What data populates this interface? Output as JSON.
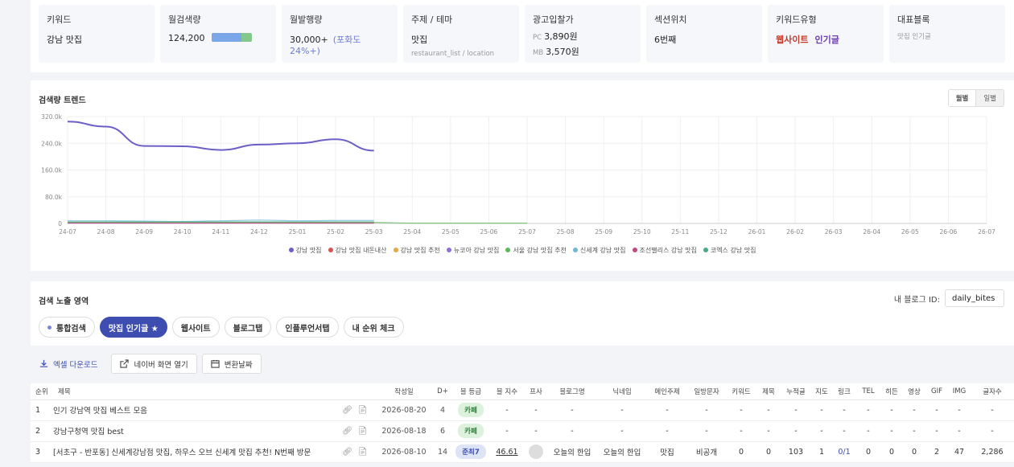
{
  "stats": [
    {
      "label": "키워드",
      "value": "강남 맛집"
    },
    {
      "label": "월검색량",
      "value": "124,200",
      "bar_fraction": 0.74
    },
    {
      "label": "월발행량",
      "value": "30,000+",
      "extra": "(포화도 24%+)"
    },
    {
      "label": "주제 / 테마",
      "value": "맛집",
      "sub": "restaurant_list / location"
    },
    {
      "label": "광고입찰가",
      "pc_label": "PC",
      "pc_value": "3,890원",
      "mb_label": "MB",
      "mb_value": "3,570원"
    },
    {
      "label": "섹션위치",
      "value": "6번째"
    },
    {
      "label": "키워드유형",
      "type1": "웹사이트",
      "type2": "인기글"
    },
    {
      "label": "대표블록",
      "sub": "맛집 인기글"
    }
  ],
  "trend": {
    "title": "검색량 트렌드",
    "toggle_on": "월별",
    "toggle_off": "일별"
  },
  "chart_data": {
    "type": "line",
    "x": [
      "24-07",
      "24-08",
      "24-09",
      "24-10",
      "24-11",
      "24-12",
      "25-01",
      "25-02",
      "25-03",
      "25-04",
      "25-05",
      "25-06",
      "25-07",
      "25-08",
      "25-09",
      "25-10",
      "25-11",
      "25-12",
      "26-01",
      "26-02",
      "26-03",
      "26-04",
      "26-05",
      "26-06",
      "26-07"
    ],
    "y_ticks": [
      "0",
      "80.0k",
      "160.0k",
      "240.0k",
      "320.0k"
    ],
    "ylim": [
      0,
      320000
    ],
    "series": [
      {
        "name": "강남 맛집",
        "color": "#6c5fc7",
        "values": [
          305000,
          290000,
          232000,
          231000,
          220000,
          236000,
          240000,
          252000,
          218000
        ]
      },
      {
        "name": "강남 맛집 내돈내산",
        "color": "#d9534f",
        "values": [
          2000,
          2000,
          1500,
          1500,
          1500,
          1500,
          1500,
          1500,
          1500
        ]
      },
      {
        "name": "강남 맛집 추천",
        "color": "#e0a84a",
        "values": [
          3000,
          3000,
          2500,
          2500,
          2500,
          2500,
          2500,
          2500,
          2500
        ]
      },
      {
        "name": "뉴코아 강남 맛집",
        "color": "#8e6fd8",
        "values": [
          1000,
          1000,
          1000,
          1000,
          1000,
          1000,
          1000,
          1000,
          1000
        ]
      },
      {
        "name": "서울 강남 맛집 추천",
        "color": "#5cb85c",
        "values": [
          3500,
          3500,
          3000,
          3000,
          3500,
          3500,
          3000,
          3000,
          3000,
          1000,
          1000,
          1000,
          1000
        ]
      },
      {
        "name": "신세계 강남 맛집",
        "color": "#6fb6d8",
        "values": [
          8000,
          8000,
          7000,
          6000,
          8000,
          10000,
          8000,
          9000,
          9000
        ]
      },
      {
        "name": "조선팰리스 강남 맛집",
        "color": "#c2477e",
        "values": [
          1000,
          1000,
          1000,
          1000,
          1000,
          1000,
          1000,
          1000,
          1000
        ]
      },
      {
        "name": "코엑스 강남 맛집",
        "color": "#4aa88a",
        "values": [
          5000,
          5000,
          5000,
          5000,
          5000,
          5000,
          5000,
          5000,
          5000
        ]
      }
    ]
  },
  "search": {
    "title": "검색 노출 영역",
    "blog_id_label": "내 블로그 ID:",
    "blog_id_value": "daily_bites",
    "tabs": [
      "통합검색",
      "맛집 인기글 ★",
      "웹사이트",
      "블로그탭",
      "인플루언서탭",
      "내 순위 체크"
    ]
  },
  "actions": {
    "excel": "엑셀 다운로드",
    "naver": "네이버 화면 열기",
    "date": "변환날짜"
  },
  "table": {
    "headers": [
      "순위",
      "제목",
      "",
      "작성일",
      "D+",
      "블 등급",
      "블 지수",
      "프사",
      "블로그명",
      "닉네임",
      "메인주제",
      "일방문자",
      "키워드",
      "제목",
      "누적글",
      "지도",
      "링크",
      "TEL",
      "히든",
      "영상",
      "GIF",
      "IMG",
      "글자수"
    ],
    "rows": [
      {
        "rank": "1",
        "title": "인기 강남역 맛집 베스트 모음",
        "date": "2026-08-20",
        "d": "4",
        "grade": "카페",
        "grade_type": "cafe",
        "index": "-",
        "photo": "-",
        "blog": "-",
        "nick": "-",
        "topic": "-",
        "visitors": "-",
        "kw": "-",
        "tt": "-",
        "posts": "-",
        "map": "-",
        "link": "-",
        "tel": "-",
        "hidden": "-",
        "video": "-",
        "gif": "-",
        "img": "-",
        "chars": "-"
      },
      {
        "rank": "2",
        "title": "강남구청역 맛집 best",
        "date": "2026-08-18",
        "d": "6",
        "grade": "카페",
        "grade_type": "cafe",
        "index": "-",
        "photo": "-",
        "blog": "-",
        "nick": "-",
        "topic": "-",
        "visitors": "-",
        "kw": "-",
        "tt": "-",
        "posts": "-",
        "map": "-",
        "link": "-",
        "tel": "-",
        "hidden": "-",
        "video": "-",
        "gif": "-",
        "img": "-",
        "chars": "-"
      },
      {
        "rank": "3",
        "title": "[서초구 - 반포동] 신세계강남점 맛집, 하우스 오브 신세계 맛집 추천! N번째 방문",
        "date": "2026-08-10",
        "d": "14",
        "grade": "준최7",
        "grade_type": "jun",
        "index": "46.61",
        "photo": "",
        "blog": "오늘의 한입",
        "nick": "오늘의 한입",
        "topic": "맛집",
        "visitors": "비공개",
        "kw": "0",
        "tt": "0",
        "posts": "103",
        "map": "1",
        "link": "0/1",
        "tel": "0",
        "hidden": "0",
        "video": "0",
        "gif": "2",
        "img": "47",
        "chars": "2,286"
      }
    ]
  }
}
